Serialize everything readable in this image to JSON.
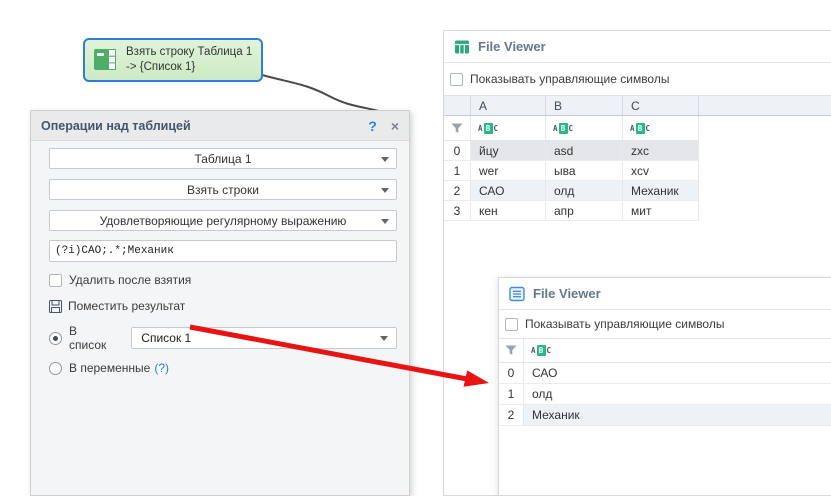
{
  "node": {
    "label": "Взять строку Таблица 1 -> {Список 1}"
  },
  "ops_panel": {
    "title": "Операции над таблицей",
    "help_label": "?",
    "close_label": "×",
    "dropdown_table": "Таблица 1",
    "dropdown_action": "Взять строки",
    "dropdown_condition": "Удовлетворяющие регулярному выражению",
    "regex_value": "(?i)САО;.*;Механик",
    "delete_after_label": "Удалить после взятия",
    "place_result_label": "Поместить результат",
    "radio_list_label": "В список",
    "list_select_value": "Список 1",
    "radio_vars_label": "В переменные",
    "radio_vars_hint": "(?)"
  },
  "viewer1": {
    "title": "File Viewer",
    "checkbox_label": "Показывать управляющие символы",
    "columns": {
      "a": "A",
      "b": "B",
      "c": "C"
    },
    "rows": [
      {
        "index": "0",
        "cells": [
          "йцу",
          "asd",
          "zxc"
        ]
      },
      {
        "index": "1",
        "cells": [
          "wer",
          "ыва",
          "xcv"
        ]
      },
      {
        "index": "2",
        "cells": [
          "САО",
          "олд",
          "Механик"
        ]
      },
      {
        "index": "3",
        "cells": [
          "кен",
          "апр",
          "мит"
        ]
      }
    ]
  },
  "viewer2": {
    "title": "File Viewer",
    "checkbox_label": "Показывать управляющие символы",
    "rows": [
      {
        "index": "0",
        "value": "САО"
      },
      {
        "index": "1",
        "value": "олд"
      },
      {
        "index": "2",
        "value": "Механик"
      }
    ]
  },
  "type_glyph": {
    "a": "A",
    "b": "B",
    "c": "C"
  },
  "colors": {
    "accent_blue": "#2f7ed8",
    "node_fill": "#d7efcf",
    "arrow_red": "#e81414",
    "glyph_teal": "#26b98a",
    "viewer1_icon_green": "#2aa87c",
    "viewer2_icon_blue": "#4189dd"
  }
}
